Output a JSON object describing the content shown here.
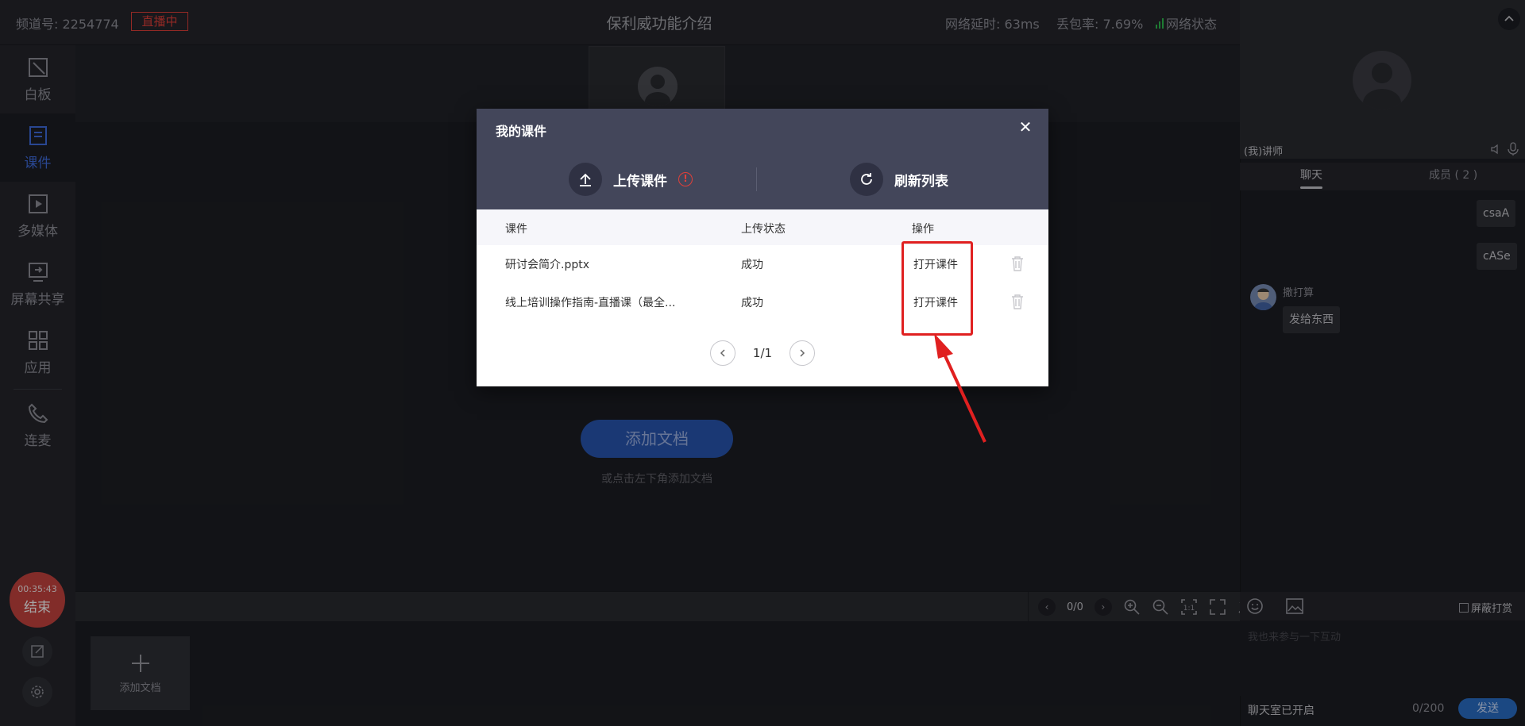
{
  "topbar": {
    "channel": "频道号: 2254774",
    "live_badge": "直播中",
    "title": "保利威功能介绍",
    "latency": "网络延时: 63ms",
    "packet_loss": "丢包率: 7.69%",
    "network_state": "网络状态"
  },
  "sidebar": {
    "items": [
      {
        "label": "白板",
        "icon": "whiteboard-icon"
      },
      {
        "label": "课件",
        "icon": "courseware-icon",
        "active": true
      },
      {
        "label": "多媒体",
        "icon": "multimedia-icon"
      },
      {
        "label": "屏幕共享",
        "icon": "screen-share-icon"
      },
      {
        "label": "应用",
        "icon": "apps-icon"
      },
      {
        "label": "连麦",
        "icon": "phone-icon"
      }
    ],
    "end_timer": "00:35:43",
    "end_label": "结束"
  },
  "stage": {
    "add_doc_button": "添加文档",
    "add_doc_hint": "或点击左下角添加文档",
    "thumb_add_doc": "添加文档",
    "page_indicator": "0/0"
  },
  "right_panel": {
    "lecturer_name": "(我)讲师",
    "tabs": [
      "聊天",
      "成员 ( 2 )"
    ],
    "messages": [
      {
        "text": "csaA"
      },
      {
        "text": "cASe"
      }
    ],
    "incoming": {
      "name": "撒打算",
      "text": "发给东西"
    },
    "block_reward_label": "屏蔽打赏",
    "input_placeholder": "我也来参与一下互动",
    "chat_status": "聊天室已开启",
    "char_count": "0/200",
    "send_label": "发送"
  },
  "modal": {
    "title": "我的课件",
    "upload_label": "上传课件",
    "refresh_label": "刷新列表",
    "columns": [
      "课件",
      "上传状态",
      "操作"
    ],
    "rows": [
      {
        "name": "研讨会简介.pptx",
        "status": "成功",
        "action": "打开课件"
      },
      {
        "name": "线上培训操作指南-直播课（最全...",
        "status": "成功",
        "action": "打开课件"
      }
    ],
    "pager": "1/1"
  },
  "colors": {
    "accent": "#3f6de0",
    "live_red": "#e0403a",
    "highlight_red": "#e02020",
    "modal_header": "#43465a"
  }
}
